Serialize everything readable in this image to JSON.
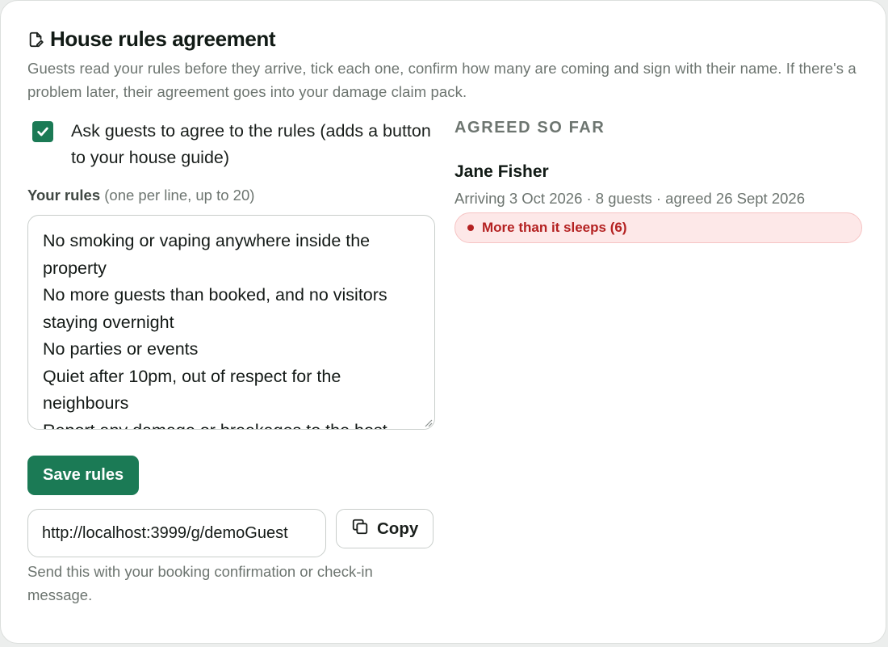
{
  "header": {
    "title": "House rules agreement",
    "description": "Guests read your rules before they arrive, tick each one, confirm how many are coming and sign with their name. If there's a problem later, their agreement goes into your damage claim pack."
  },
  "agreement_toggle": {
    "checked": true,
    "label": "Ask guests to agree to the rules (adds a button to your house guide)"
  },
  "rules": {
    "label": "Your rules",
    "hint": "(one per line, up to 20)",
    "lines": [
      "No smoking or vaping anywhere inside the property",
      "No more guests than booked, and no visitors staying overnight",
      "No parties or events",
      "Quiet after 10pm, out of respect for the neighbours",
      "Report any damage or breakages to the host"
    ],
    "save_label": "Save rules"
  },
  "share": {
    "link": "http://localhost:3999/g/demoGuest",
    "copy_label": "Copy",
    "hint": "Send this with your booking confirmation or check-in message."
  },
  "agreed": {
    "heading": "AGREED SO FAR",
    "guests": [
      {
        "name": "Jane Fisher",
        "meta": "Arriving 3 Oct 2026 · 8 guests · agreed 26 Sept 2026",
        "warning": "More than it sleeps (6)"
      }
    ]
  },
  "colors": {
    "accent": "#1b7a55",
    "warning_text": "#b42121",
    "warning_bg": "#fde8e8"
  },
  "icons": {
    "title": "edit-document-icon",
    "copy": "copy-icon",
    "checkbox": "checkmark-icon"
  }
}
